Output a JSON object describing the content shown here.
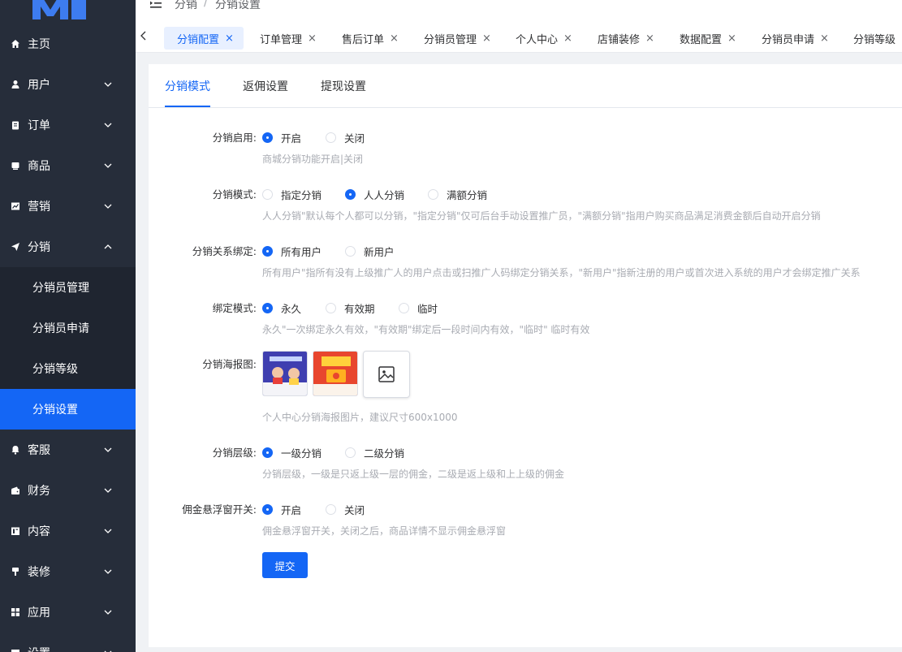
{
  "sidebar": {
    "menu": [
      {
        "label": "主页",
        "icon": "home-icon"
      },
      {
        "label": "用户",
        "icon": "user-icon"
      },
      {
        "label": "订单",
        "icon": "clipboard-icon"
      },
      {
        "label": "商品",
        "icon": "product-icon"
      },
      {
        "label": "营销",
        "icon": "chart-icon"
      },
      {
        "label": "分销",
        "icon": "send-icon"
      },
      {
        "label": "客服",
        "icon": "bell-icon"
      },
      {
        "label": "财务",
        "icon": "wallet-icon"
      },
      {
        "label": "内容",
        "icon": "book-icon"
      },
      {
        "label": "装修",
        "icon": "brush-icon"
      },
      {
        "label": "应用",
        "icon": "apps-icon"
      },
      {
        "label": "设置",
        "icon": "settings-icon"
      }
    ],
    "submenu": [
      {
        "label": "分销员管理"
      },
      {
        "label": "分销员申请"
      },
      {
        "label": "分销等级"
      },
      {
        "label": "分销设置"
      }
    ]
  },
  "header": {
    "breadcrumb": [
      "分销",
      "/",
      "分销设置"
    ]
  },
  "tabs": [
    {
      "label": "分销配置",
      "active": true
    },
    {
      "label": "订单管理"
    },
    {
      "label": "售后订单"
    },
    {
      "label": "分销员管理"
    },
    {
      "label": "个人中心"
    },
    {
      "label": "店铺装修"
    },
    {
      "label": "数据配置"
    },
    {
      "label": "分销员申请"
    },
    {
      "label": "分销等级"
    }
  ],
  "tab_close": "×",
  "subtabs": [
    "分销模式",
    "返佣设置",
    "提现设置"
  ],
  "form": {
    "enable": {
      "label": "分销启用:",
      "options": [
        "开启",
        "关闭"
      ],
      "selected": 0,
      "help": "商城分销功能开启|关闭"
    },
    "mode": {
      "label": "分销模式:",
      "options": [
        "指定分销",
        "人人分销",
        "满额分销"
      ],
      "selected": 1,
      "help": "人人分销\"默认每个人都可以分销，\"指定分销\"仅可后台手动设置推广员，\"满额分销\"指用户购买商品满足消费金额后自动开启分销"
    },
    "binding": {
      "label": "分销关系绑定:",
      "options": [
        "所有用户",
        "新用户"
      ],
      "selected": 0,
      "help": "所有用户\"指所有没有上级推广人的用户点击或扫推广人码绑定分销关系，\"新用户\"指新注册的用户或首次进入系统的用户才会绑定推广关系"
    },
    "bind_mode": {
      "label": "绑定模式:",
      "options": [
        "永久",
        "有效期",
        "临时"
      ],
      "selected": 0,
      "help": "永久\"一次绑定永久有效，\"有效期\"绑定后一段时间内有效，\"临时\" 临时有效"
    },
    "poster": {
      "label": "分销海报图:",
      "help": "个人中心分销海报图片，建议尺寸600x1000"
    },
    "level": {
      "label": "分销层级:",
      "options": [
        "一级分销",
        "二级分销"
      ],
      "selected": 0,
      "help": "分销层级，一级是只返上级一层的佣金，二级是返上级和上上级的佣金"
    },
    "float": {
      "label": "佣金悬浮窗开关:",
      "options": [
        "开启",
        "关闭"
      ],
      "selected": 0,
      "help": "佣金悬浮窗开关，关闭之后，商品详情不显示佣金悬浮窗"
    }
  },
  "submit_label": "提交",
  "colors": {
    "accent": "#1466f5",
    "sidebar_bg": "#262d3a"
  }
}
